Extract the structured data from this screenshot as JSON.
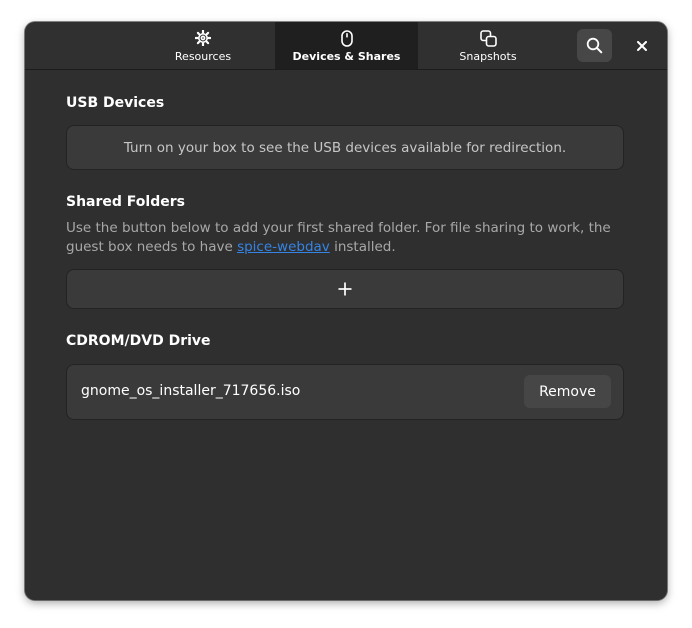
{
  "header": {
    "tabs": [
      {
        "label": "Resources",
        "icon": "gear-icon",
        "active": false
      },
      {
        "label": "Devices & Shares",
        "icon": "mouse-icon",
        "active": true
      },
      {
        "label": "Snapshots",
        "icon": "snapshot-icon",
        "active": false
      }
    ],
    "search_icon": "search-icon",
    "close_icon": "close-icon"
  },
  "usb": {
    "title": "USB Devices",
    "message": "Turn on your box to see the USB devices available for redirection."
  },
  "shared_folders": {
    "title": "Shared Folders",
    "description_before": "Use the button below to add your first shared folder. For file sharing to work, the guest box needs to have ",
    "link_text": "spice-webdav",
    "description_after": " installed.",
    "add_icon": "plus-icon"
  },
  "cdrom": {
    "title": "CDROM/DVD Drive",
    "iso_name": "gnome_os_installer_717656.iso",
    "remove_label": "Remove"
  },
  "colors": {
    "window_bg": "#2f2f2f",
    "card_bg": "#3a3a3a",
    "active_tab_bg": "#1f1f1f",
    "link": "#3584e4"
  }
}
